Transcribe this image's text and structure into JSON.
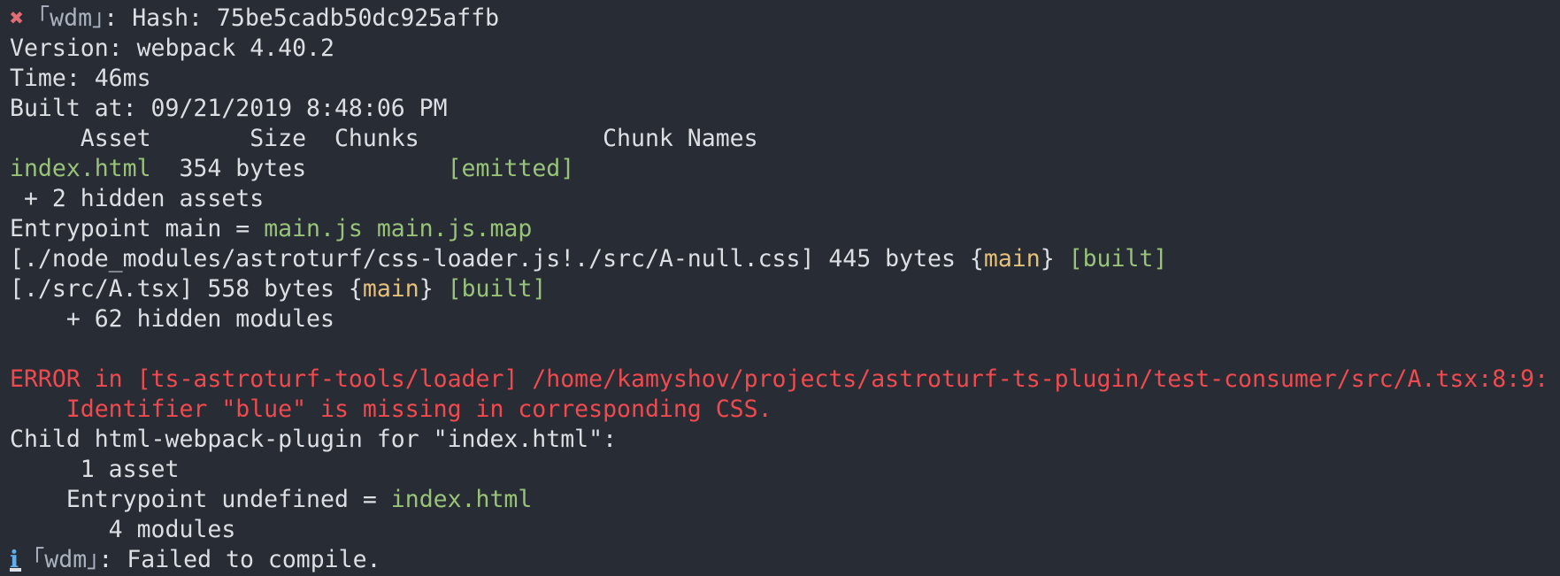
{
  "colors": {
    "background": "#282c34",
    "default": "#dcdfe4",
    "green": "#98c379",
    "yellow": "#e5c07b",
    "red": "#f04a4f",
    "error_icon": "#e06c75",
    "info_icon": "#61afef"
  },
  "lines": [
    {
      "name": "hash-line",
      "segments": [
        {
          "text": "✖",
          "color": "error-x",
          "icon": "error-x-icon"
        },
        {
          "text": " ｢wdm｣",
          "color": "dim"
        },
        {
          "text": ": Hash: 75be5cadb50dc925affb",
          "color": "default"
        }
      ]
    },
    {
      "name": "version-line",
      "segments": [
        {
          "text": "Version: webpack 4.40.2",
          "color": "default"
        }
      ]
    },
    {
      "name": "time-line",
      "segments": [
        {
          "text": "Time: 46ms",
          "color": "default"
        }
      ]
    },
    {
      "name": "built-at-line",
      "segments": [
        {
          "text": "Built at: 09/21/2019 8:48:06 PM",
          "color": "default"
        }
      ]
    },
    {
      "name": "asset-table-header",
      "segments": [
        {
          "text": "     Asset       Size  Chunks             Chunk Names",
          "color": "default"
        }
      ]
    },
    {
      "name": "asset-row-index-html",
      "segments": [
        {
          "text": "index.html",
          "color": "green"
        },
        {
          "text": "  354 bytes          ",
          "color": "default"
        },
        {
          "text": "[emitted]",
          "color": "green"
        }
      ]
    },
    {
      "name": "hidden-assets-line",
      "segments": [
        {
          "text": " + 2 hidden assets",
          "color": "default"
        }
      ]
    },
    {
      "name": "entrypoint-line",
      "segments": [
        {
          "text": "Entrypoint main = ",
          "color": "default"
        },
        {
          "text": "main.js main.js.map",
          "color": "green"
        }
      ]
    },
    {
      "name": "module-line-css",
      "segments": [
        {
          "text": "[./node_modules/astroturf/css-loader.js!./src/A-null.css] 445 bytes {",
          "color": "default"
        },
        {
          "text": "main",
          "color": "yellow"
        },
        {
          "text": "} ",
          "color": "default"
        },
        {
          "text": "[built]",
          "color": "green"
        }
      ]
    },
    {
      "name": "module-line-tsx",
      "segments": [
        {
          "text": "[./src/A.tsx] 558 bytes {",
          "color": "default"
        },
        {
          "text": "main",
          "color": "yellow"
        },
        {
          "text": "} ",
          "color": "default"
        },
        {
          "text": "[built]",
          "color": "green"
        }
      ]
    },
    {
      "name": "hidden-modules-line",
      "segments": [
        {
          "text": "    + 62 hidden modules",
          "color": "default"
        }
      ]
    },
    {
      "name": "blank-line",
      "segments": [
        {
          "text": "",
          "color": "default"
        }
      ]
    },
    {
      "name": "error-header-line",
      "segments": [
        {
          "text": "ERROR in [ts-astroturf-tools/loader] /home/kamyshov/projects/astroturf-ts-plugin/test-consumer/src/A.tsx:8:9:",
          "color": "red"
        }
      ]
    },
    {
      "name": "error-message-line",
      "segments": [
        {
          "text": "    Identifier \"blue\" is missing in corresponding CSS.",
          "color": "red"
        }
      ]
    },
    {
      "name": "child-plugin-line",
      "segments": [
        {
          "text": "Child html-webpack-plugin for \"index.html\":",
          "color": "default"
        }
      ]
    },
    {
      "name": "child-asset-count-line",
      "segments": [
        {
          "text": "     1 asset",
          "color": "default"
        }
      ]
    },
    {
      "name": "child-entrypoint-line",
      "segments": [
        {
          "text": "    Entrypoint undefined = ",
          "color": "default"
        },
        {
          "text": "index.html",
          "color": "green"
        }
      ]
    },
    {
      "name": "child-modules-line",
      "segments": [
        {
          "text": "       4 modules",
          "color": "default"
        }
      ]
    },
    {
      "name": "failed-compile-line",
      "segments": [
        {
          "text": "ℹ",
          "color": "blue",
          "icon": "info-icon"
        },
        {
          "text": " ｢wdm｣",
          "color": "dim"
        },
        {
          "text": ": Failed to compile.",
          "color": "default"
        }
      ]
    }
  ]
}
